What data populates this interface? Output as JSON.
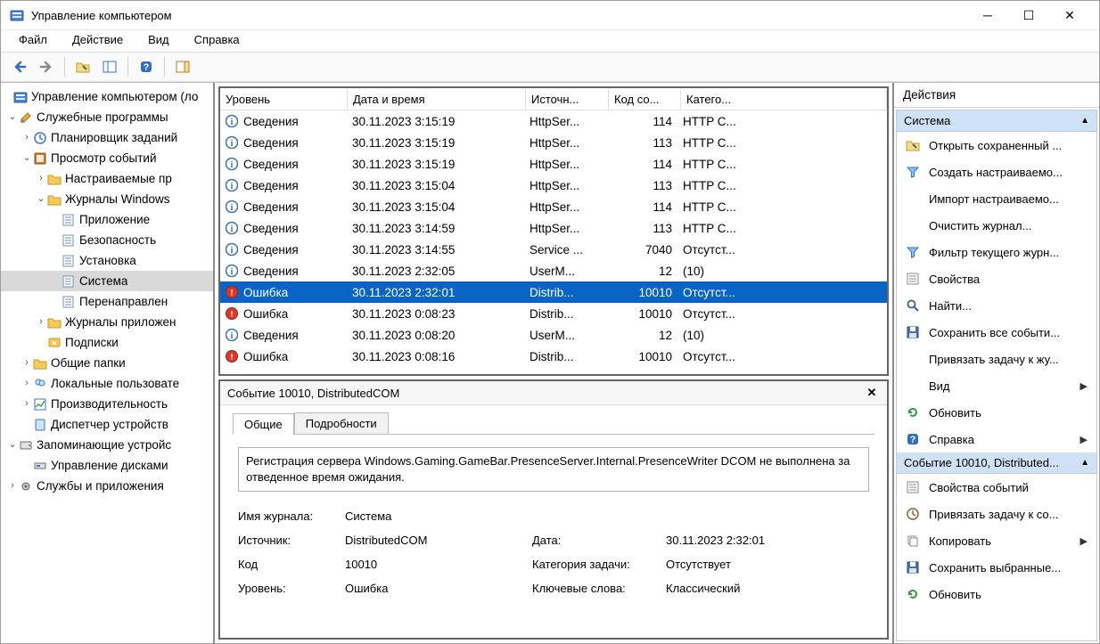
{
  "window": {
    "title": "Управление компьютером"
  },
  "menu": [
    "Файл",
    "Действие",
    "Вид",
    "Справка"
  ],
  "tree": {
    "root": "Управление компьютером (ло",
    "util": "Служебные программы",
    "scheduler": "Планировщик заданий",
    "viewer": "Просмотр событий",
    "custom": "Настраиваемые пр",
    "winlogs": "Журналы Windows",
    "app": "Приложение",
    "sec": "Безопасность",
    "setup": "Установка",
    "system": "Система",
    "forward": "Перенаправлен",
    "applogs": "Журналы приложен",
    "subs": "Подписки",
    "shared": "Общие папки",
    "users": "Локальные пользовате",
    "perf": "Производительность",
    "devmgr": "Диспетчер устройств",
    "storage": "Запоминающие устройс",
    "diskmgr": "Управление дисками",
    "services": "Службы и приложения"
  },
  "list": {
    "headers": {
      "level": "Уровень",
      "date": "Дата и время",
      "source": "Источн...",
      "code": "Код со...",
      "cat": "Катего..."
    },
    "rows": [
      {
        "lvl": "info",
        "level": "Сведения",
        "date": "30.11.2023 3:15:19",
        "source": "HttpSer...",
        "code": "114",
        "cat": "HTTP С..."
      },
      {
        "lvl": "info",
        "level": "Сведения",
        "date": "30.11.2023 3:15:19",
        "source": "HttpSer...",
        "code": "113",
        "cat": "HTTP С..."
      },
      {
        "lvl": "info",
        "level": "Сведения",
        "date": "30.11.2023 3:15:19",
        "source": "HttpSer...",
        "code": "114",
        "cat": "HTTP С..."
      },
      {
        "lvl": "info",
        "level": "Сведения",
        "date": "30.11.2023 3:15:04",
        "source": "HttpSer...",
        "code": "113",
        "cat": "HTTP С..."
      },
      {
        "lvl": "info",
        "level": "Сведения",
        "date": "30.11.2023 3:15:04",
        "source": "HttpSer...",
        "code": "114",
        "cat": "HTTP С..."
      },
      {
        "lvl": "info",
        "level": "Сведения",
        "date": "30.11.2023 3:14:59",
        "source": "HttpSer...",
        "code": "113",
        "cat": "HTTP С..."
      },
      {
        "lvl": "info",
        "level": "Сведения",
        "date": "30.11.2023 3:14:55",
        "source": "Service ...",
        "code": "7040",
        "cat": "Отсутст..."
      },
      {
        "lvl": "info",
        "level": "Сведения",
        "date": "30.11.2023 2:32:05",
        "source": "UserM...",
        "code": "12",
        "cat": "(10)"
      },
      {
        "lvl": "error",
        "level": "Ошибка",
        "date": "30.11.2023 2:32:01",
        "source": "Distrib...",
        "code": "10010",
        "cat": "Отсутст...",
        "selected": true
      },
      {
        "lvl": "error",
        "level": "Ошибка",
        "date": "30.11.2023 0:08:23",
        "source": "Distrib...",
        "code": "10010",
        "cat": "Отсутст..."
      },
      {
        "lvl": "info",
        "level": "Сведения",
        "date": "30.11.2023 0:08:20",
        "source": "UserM...",
        "code": "12",
        "cat": "(10)"
      },
      {
        "lvl": "error",
        "level": "Ошибка",
        "date": "30.11.2023 0:08:16",
        "source": "Distrib...",
        "code": "10010",
        "cat": "Отсутст..."
      }
    ]
  },
  "detail": {
    "title": "Событие 10010, DistributedCOM",
    "tabs": {
      "general": "Общие",
      "details": "Подробности"
    },
    "message": "Регистрация сервера Windows.Gaming.GameBar.PresenceServer.Internal.PresenceWriter DCOM не выполнена за отведенное время ожидания.",
    "labels": {
      "log": "Имя журнала:",
      "source": "Источник:",
      "code": "Код",
      "level": "Уровень:",
      "date": "Дата:",
      "taskcat": "Категория задачи:",
      "keywords": "Ключевые слова:"
    },
    "values": {
      "log": "Система",
      "source": "DistributedCOM",
      "code": "10010",
      "level": "Ошибка",
      "date": "30.11.2023 2:32:01",
      "taskcat": "Отсутствует",
      "keywords": "Классический"
    }
  },
  "actions": {
    "title": "Действия",
    "section1": "Система",
    "items1": [
      {
        "label": "Открыть сохраненный ...",
        "icon": "folder"
      },
      {
        "label": "Создать настраиваемо...",
        "icon": "funnel"
      },
      {
        "label": "Импорт настраиваемо...",
        "icon": ""
      },
      {
        "label": "Очистить журнал...",
        "icon": ""
      },
      {
        "label": "Фильтр текущего журн...",
        "icon": "funnel"
      },
      {
        "label": "Свойства",
        "icon": "props"
      },
      {
        "label": "Найти...",
        "icon": "find"
      },
      {
        "label": "Сохранить все событи...",
        "icon": "save"
      },
      {
        "label": "Привязать задачу к жу...",
        "icon": ""
      },
      {
        "label": "Вид",
        "icon": "",
        "arrow": true
      },
      {
        "label": "Обновить",
        "icon": "refresh"
      },
      {
        "label": "Справка",
        "icon": "help",
        "arrow": true
      }
    ],
    "section2": "Событие 10010, Distributed...",
    "items2": [
      {
        "label": "Свойства событий",
        "icon": "props"
      },
      {
        "label": "Привязать задачу к со...",
        "icon": "attach"
      },
      {
        "label": "Копировать",
        "icon": "copy",
        "arrow": true
      },
      {
        "label": "Сохранить выбранные...",
        "icon": "save"
      },
      {
        "label": "Обновить",
        "icon": "refresh"
      }
    ]
  }
}
